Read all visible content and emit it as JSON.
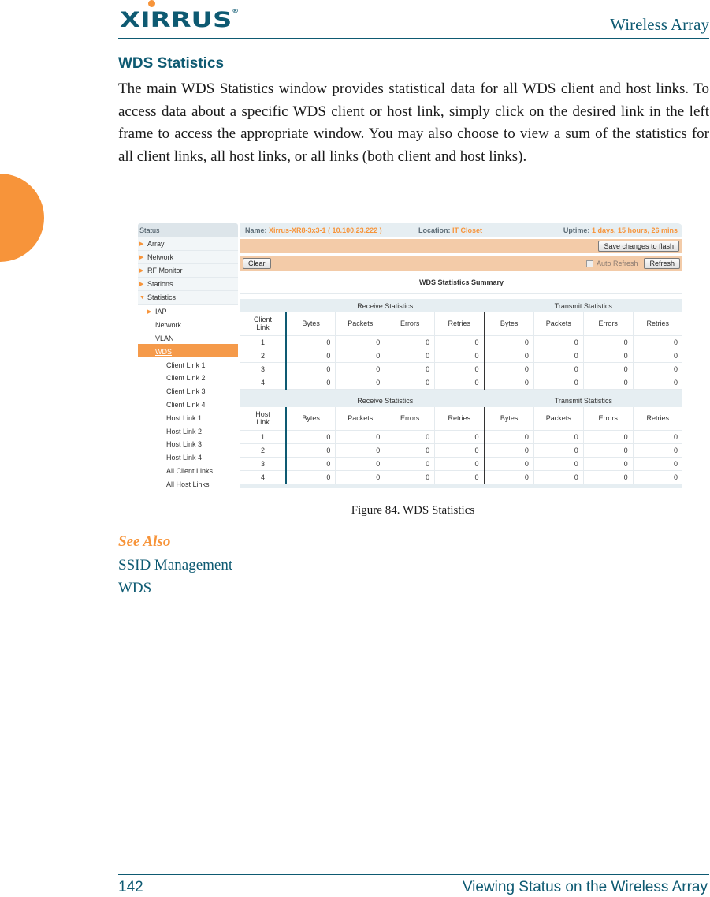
{
  "page": {
    "brand": "XIRRUS",
    "brand_mark": "®",
    "header_title": "Wireless Array",
    "section_title": "WDS Statistics",
    "body_text": "The main WDS Statistics window provides statistical data for all WDS client and host links. To access data about a specific WDS client or host link, simply click on the desired link in the left frame to access the appropriate window. You may also choose to view a sum of the statistics for all client links, all host links, or all links (both client and host links).",
    "figure_caption": "Figure 84. WDS Statistics",
    "see_also_heading": "See Also",
    "see_also_links": [
      "SSID Management",
      "WDS"
    ],
    "footer_page_number": "142",
    "footer_title": "Viewing Status on the Wireless Array"
  },
  "colors": {
    "brand_teal": "#0e5a72",
    "accent_orange": "#f7943a",
    "toolbar_peach": "#f3cba8",
    "nav_active": "#f59a4a"
  },
  "screenshot": {
    "nav": {
      "status_label": "Status",
      "top_items": [
        {
          "label": "Array",
          "icon": "triangle-right-icon"
        },
        {
          "label": "Network",
          "icon": "triangle-right-icon"
        },
        {
          "label": "RF Monitor",
          "icon": "triangle-right-icon"
        },
        {
          "label": "Stations",
          "icon": "triangle-right-icon"
        },
        {
          "label": "Statistics",
          "icon": "triangle-down-icon"
        }
      ],
      "stats_items": [
        {
          "label": "IAP",
          "icon": "triangle-right-icon"
        },
        {
          "label": "Network"
        },
        {
          "label": "VLAN"
        },
        {
          "label": "WDS",
          "active": true
        }
      ],
      "wds_items": [
        "Client Link 1",
        "Client Link 2",
        "Client Link 3",
        "Client Link 4",
        "Host Link 1",
        "Host Link 2",
        "Host Link 3",
        "Host Link 4",
        "All Client Links",
        "All Host Links"
      ]
    },
    "info": {
      "name_label": "Name:",
      "name_value": "Xirrus-XR8-3x3-1   ( 10.100.23.222 )",
      "location_label": "Location:",
      "location_value": "IT Closet",
      "uptime_label": "Uptime:",
      "uptime_value": "1 days, 15 hours, 26 mins"
    },
    "toolbar": {
      "save_label": "Save changes to flash",
      "clear_label": "Clear",
      "auto_refresh_label": "Auto Refresh",
      "auto_refresh_checked": false,
      "refresh_label": "Refresh"
    },
    "summary_title": "WDS Statistics Summary",
    "tables": [
      {
        "link_header": [
          "Client",
          "Link"
        ],
        "receive_label": "Receive Statistics",
        "transmit_label": "Transmit Statistics",
        "columns": [
          "Bytes",
          "Packets",
          "Errors",
          "Retries"
        ],
        "rows": [
          {
            "id": "1",
            "rx": [
              "0",
              "0",
              "0",
              "0"
            ],
            "tx": [
              "0",
              "0",
              "0",
              "0"
            ]
          },
          {
            "id": "2",
            "rx": [
              "0",
              "0",
              "0",
              "0"
            ],
            "tx": [
              "0",
              "0",
              "0",
              "0"
            ]
          },
          {
            "id": "3",
            "rx": [
              "0",
              "0",
              "0",
              "0"
            ],
            "tx": [
              "0",
              "0",
              "0",
              "0"
            ]
          },
          {
            "id": "4",
            "rx": [
              "0",
              "0",
              "0",
              "0"
            ],
            "tx": [
              "0",
              "0",
              "0",
              "0"
            ]
          }
        ]
      },
      {
        "link_header": [
          "Host",
          "Link"
        ],
        "receive_label": "Receive Statistics",
        "transmit_label": "Transmit Statistics",
        "columns": [
          "Bytes",
          "Packets",
          "Errors",
          "Retries"
        ],
        "rows": [
          {
            "id": "1",
            "rx": [
              "0",
              "0",
              "0",
              "0"
            ],
            "tx": [
              "0",
              "0",
              "0",
              "0"
            ]
          },
          {
            "id": "2",
            "rx": [
              "0",
              "0",
              "0",
              "0"
            ],
            "tx": [
              "0",
              "0",
              "0",
              "0"
            ]
          },
          {
            "id": "3",
            "rx": [
              "0",
              "0",
              "0",
              "0"
            ],
            "tx": [
              "0",
              "0",
              "0",
              "0"
            ]
          },
          {
            "id": "4",
            "rx": [
              "0",
              "0",
              "0",
              "0"
            ],
            "tx": [
              "0",
              "0",
              "0",
              "0"
            ]
          }
        ]
      }
    ]
  }
}
